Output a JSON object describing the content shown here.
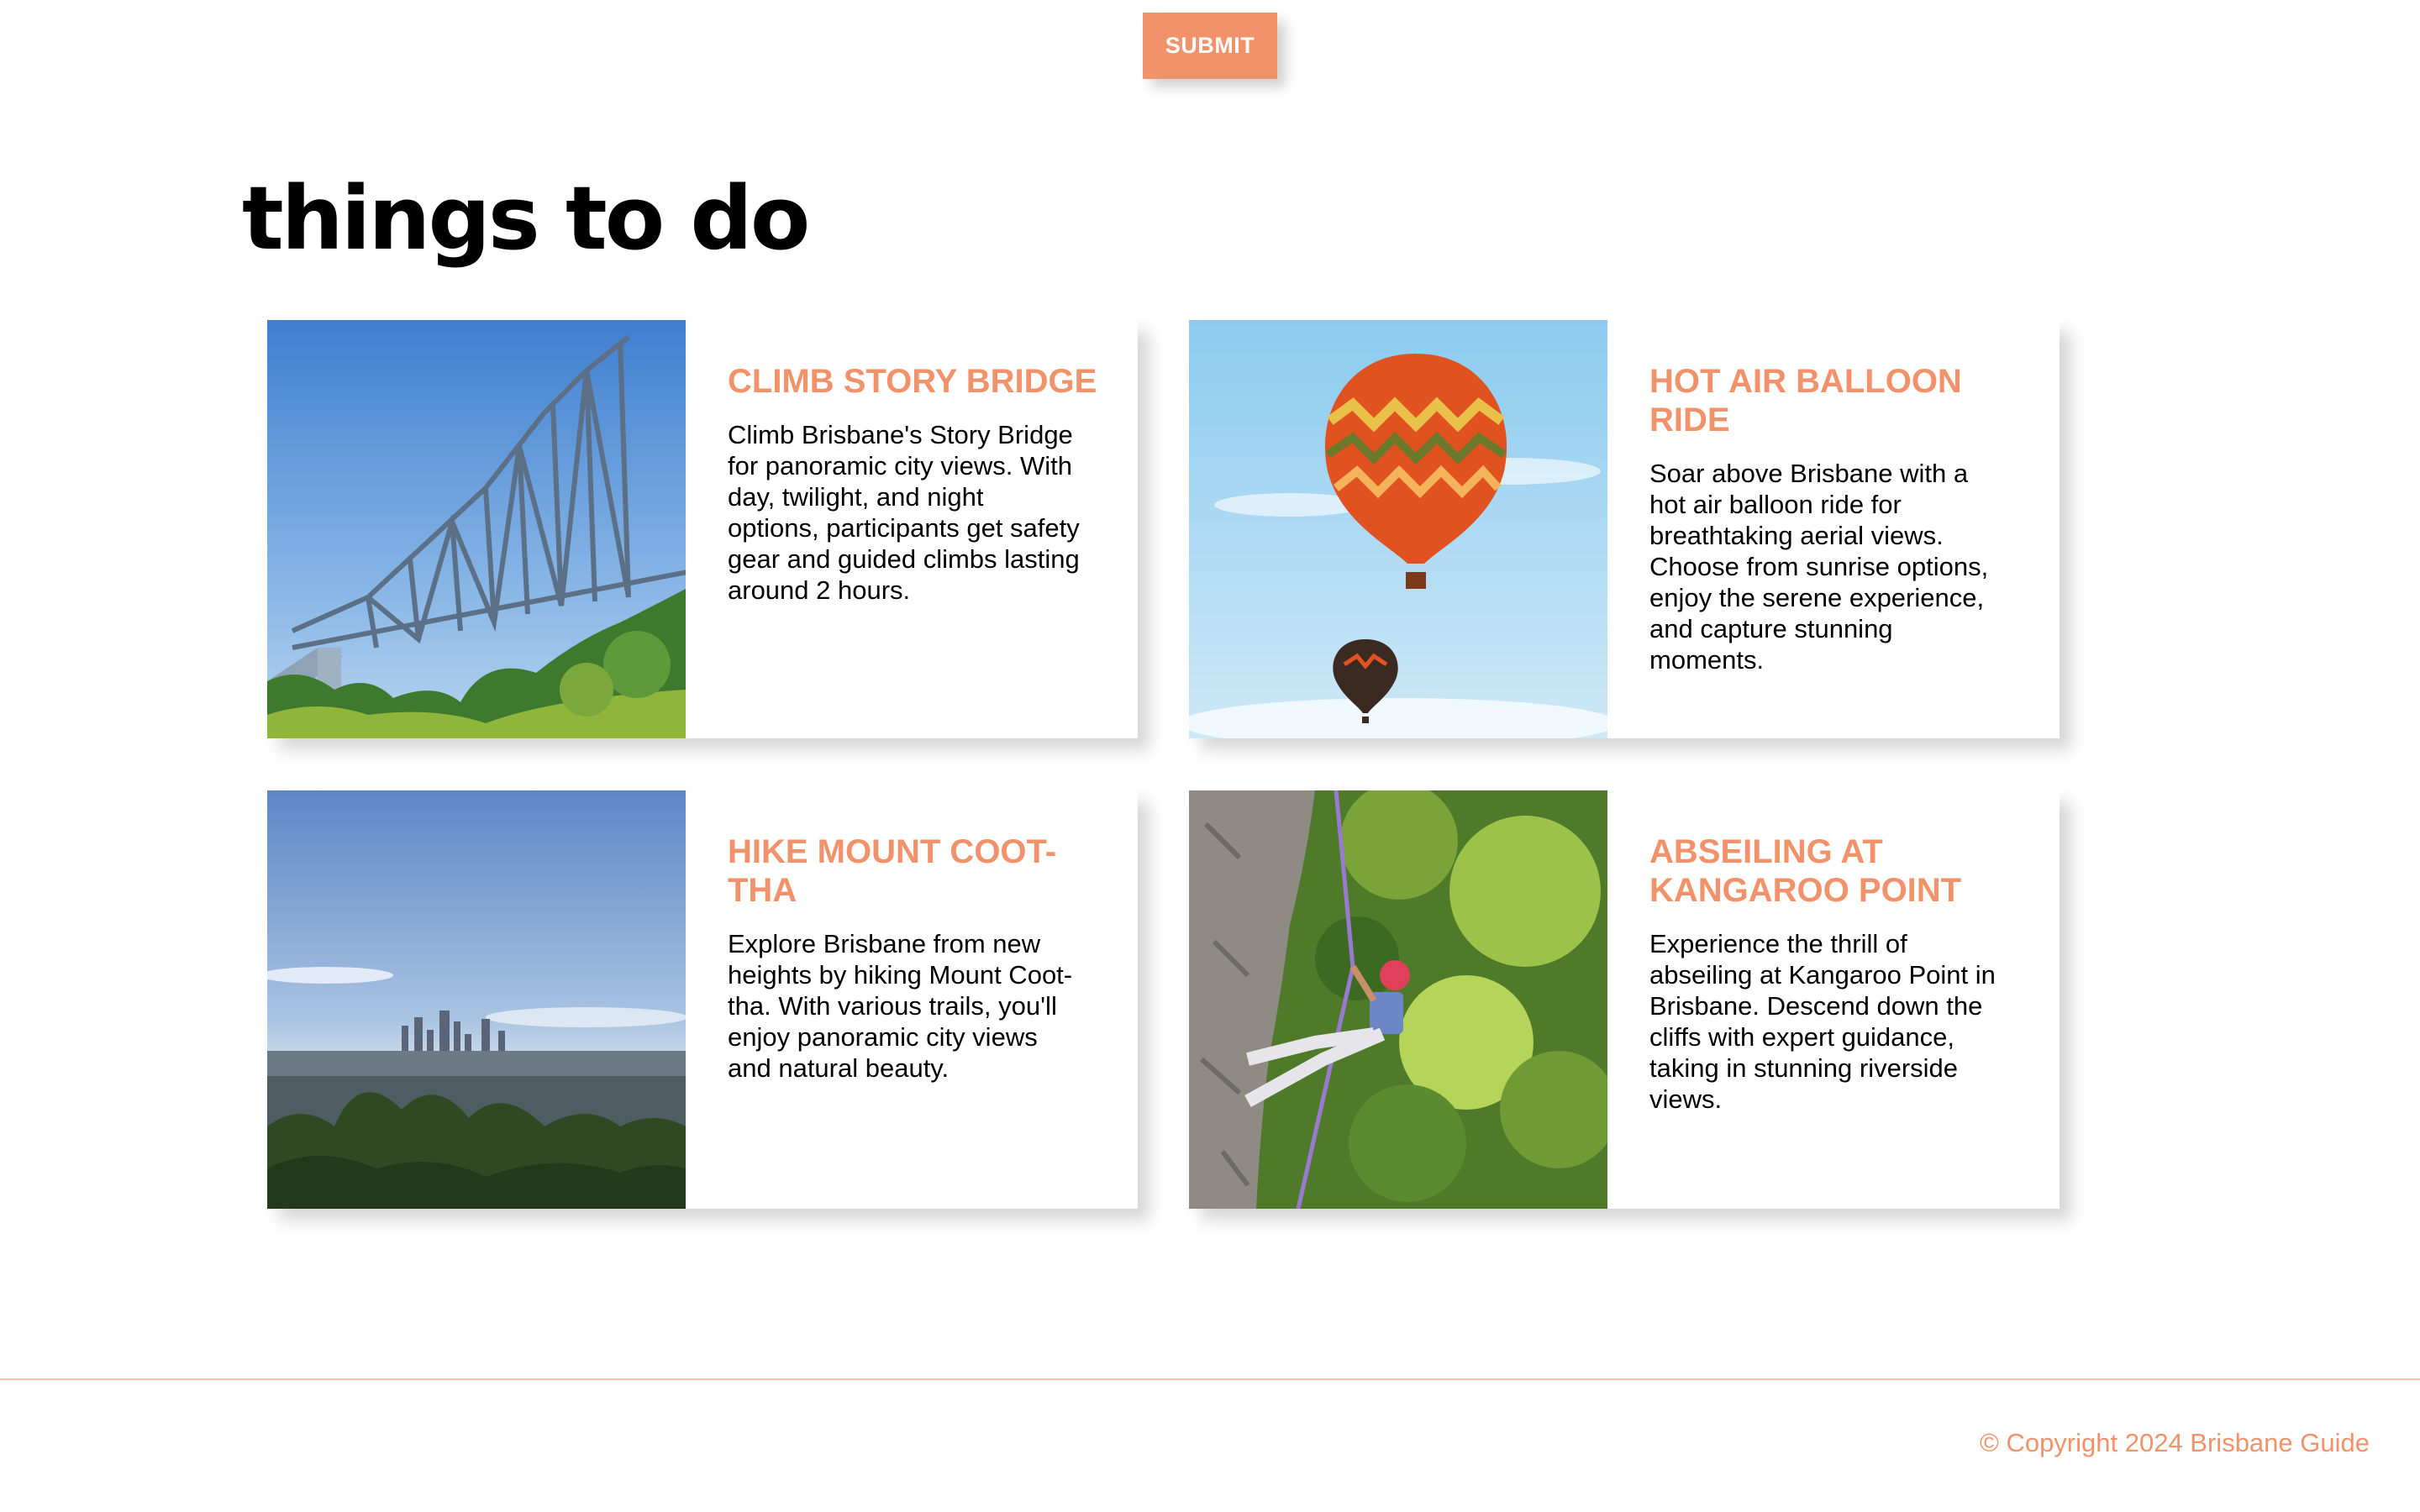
{
  "form": {
    "submit_label": "SUBMIT"
  },
  "section": {
    "title": "things to do"
  },
  "cards": [
    {
      "title": "CLIMB STORY BRIDGE",
      "text": "Climb Brisbane's Story Bridge for panoramic city views. With day, twilight, and night options, participants get safety gear and guided climbs lasting around 2 hours.",
      "image_icon": "bridge-photo"
    },
    {
      "title": "HOT AIR BALLOON RIDE",
      "text": "Soar above Brisbane with a hot air balloon ride for breathtaking aerial views. Choose from sunrise options, enjoy the serene experience, and capture stunning moments.",
      "image_icon": "balloon-photo"
    },
    {
      "title": "HIKE MOUNT COOT-THA",
      "text": "Explore Brisbane from new heights by hiking Mount Coot-tha. With various trails, you'll enjoy panoramic city views and natural beauty.",
      "image_icon": "city-view-photo"
    },
    {
      "title": "ABSEILING AT KANGAROO POINT",
      "text": "Experience the thrill of abseiling at Kangaroo Point in Brisbane. Descend down the cliffs with expert guidance, taking in stunning riverside views.",
      "image_icon": "abseiling-photo"
    }
  ],
  "footer": {
    "copyright": "© Copyright 2024 Brisbane Guide"
  },
  "colors": {
    "accent": "#f2926a",
    "footer_line": "#f3c2a8"
  }
}
